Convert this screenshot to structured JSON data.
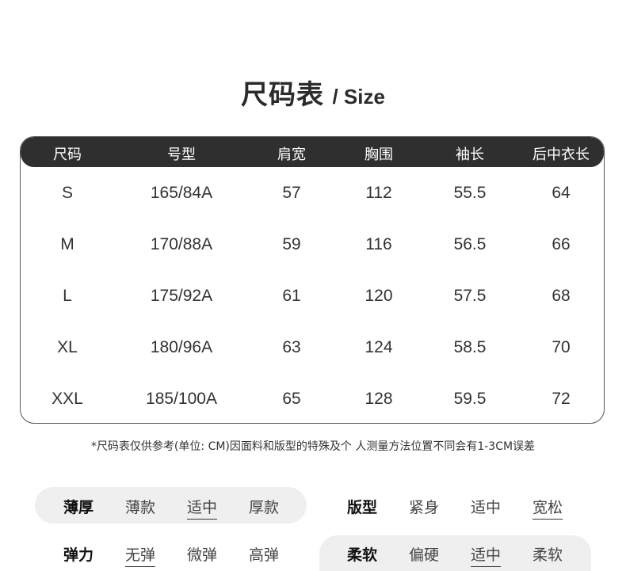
{
  "title": {
    "zh": "尺码表",
    "en": "/ Size"
  },
  "table": {
    "headers": [
      "尺码",
      "号型",
      "肩宽",
      "胸围",
      "袖长",
      "后中衣长"
    ],
    "rows": [
      [
        "S",
        "165/84A",
        "57",
        "112",
        "55.5",
        "64"
      ],
      [
        "M",
        "170/88A",
        "59",
        "116",
        "56.5",
        "66"
      ],
      [
        "L",
        "175/92A",
        "61",
        "120",
        "57.5",
        "68"
      ],
      [
        "XL",
        "180/96A",
        "63",
        "124",
        "58.5",
        "70"
      ],
      [
        "XXL",
        "185/100A",
        "65",
        "128",
        "59.5",
        "72"
      ]
    ]
  },
  "note": "*尺码表仅供参考(单位: CM)因面料和版型的特殊及个 人测量方法位置不同会有1-3CM误差",
  "attributes": {
    "thickness": {
      "label": "薄厚",
      "options": [
        "薄款",
        "适中",
        "厚款"
      ],
      "selected": "适中"
    },
    "fit": {
      "label": "版型",
      "options": [
        "紧身",
        "适中",
        "宽松"
      ],
      "selected": "宽松"
    },
    "elasticity": {
      "label": "弹力",
      "options": [
        "无弹",
        "微弹",
        "高弹"
      ],
      "selected": "无弹"
    },
    "softness": {
      "label": "柔软",
      "options": [
        "偏硬",
        "适中",
        "柔软"
      ],
      "selected": "适中"
    }
  }
}
